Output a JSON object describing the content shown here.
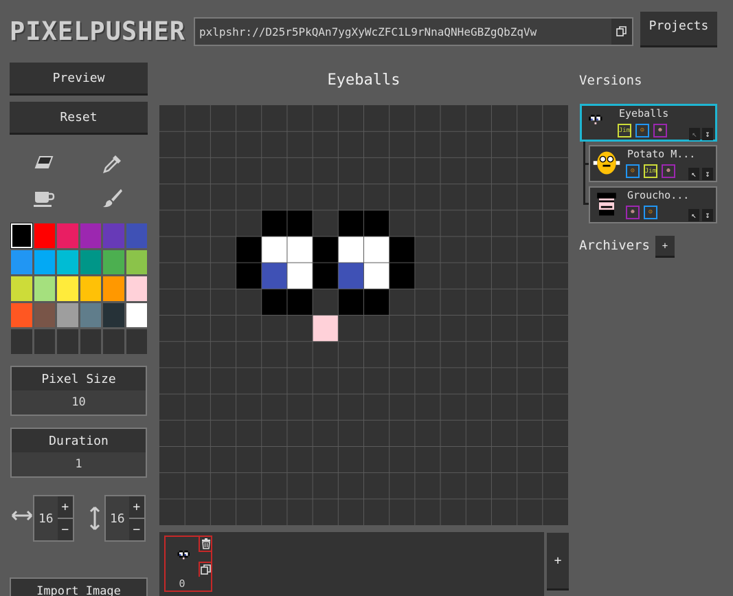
{
  "app": {
    "logo": "PIXELPUSHER",
    "url": "pxlpshr://D25r5PkQAn7ygXyWcZFC1L9rNnaQNHeGBZgQbZqVw",
    "projects_label": "Projects"
  },
  "left_panel": {
    "preview_label": "Preview",
    "reset_label": "Reset",
    "tools": [
      "eraser-icon",
      "eyedropper-icon",
      "fill-bucket-icon",
      "brush-icon"
    ],
    "palette": [
      "#000000",
      "#ff0000",
      "#e91e63",
      "#9c27b0",
      "#673ab7",
      "#3f51b5",
      "#2196f3",
      "#03a9f4",
      "#00bcd4",
      "#009688",
      "#4caf50",
      "#8bc34a",
      "#cddc39",
      "#a5e07e",
      "#ffeb3b",
      "#ffc107",
      "#ff9800",
      "#ffd1d9",
      "#ff5722",
      "#795548",
      "#9e9e9e",
      "#607d8b",
      "#263238",
      "#ffffff",
      "#333333",
      "#333333",
      "#333333",
      "#333333",
      "#333333",
      "#333333"
    ],
    "selected_swatch": 0,
    "pixel_size": {
      "label": "Pixel Size",
      "value": "10"
    },
    "duration": {
      "label": "Duration",
      "value": "1"
    },
    "width": {
      "value": "16",
      "plus": "+",
      "minus": "−"
    },
    "height": {
      "value": "16",
      "plus": "+",
      "minus": "−"
    },
    "import_label": "Import Image"
  },
  "canvas": {
    "title": "Eyeballs",
    "cols": 16,
    "rows": 16,
    "background": "#333333",
    "grid_color": "#5a5a5a",
    "pixels": [
      {
        "x": 4,
        "y": 4,
        "c": "#000000"
      },
      {
        "x": 5,
        "y": 4,
        "c": "#000000"
      },
      {
        "x": 7,
        "y": 4,
        "c": "#000000"
      },
      {
        "x": 8,
        "y": 4,
        "c": "#000000"
      },
      {
        "x": 3,
        "y": 5,
        "c": "#000000"
      },
      {
        "x": 4,
        "y": 5,
        "c": "#ffffff"
      },
      {
        "x": 5,
        "y": 5,
        "c": "#ffffff"
      },
      {
        "x": 6,
        "y": 5,
        "c": "#000000"
      },
      {
        "x": 7,
        "y": 5,
        "c": "#ffffff"
      },
      {
        "x": 8,
        "y": 5,
        "c": "#ffffff"
      },
      {
        "x": 9,
        "y": 5,
        "c": "#000000"
      },
      {
        "x": 3,
        "y": 6,
        "c": "#000000"
      },
      {
        "x": 4,
        "y": 6,
        "c": "#3f51b5"
      },
      {
        "x": 5,
        "y": 6,
        "c": "#ffffff"
      },
      {
        "x": 6,
        "y": 6,
        "c": "#000000"
      },
      {
        "x": 7,
        "y": 6,
        "c": "#3f51b5"
      },
      {
        "x": 8,
        "y": 6,
        "c": "#ffffff"
      },
      {
        "x": 9,
        "y": 6,
        "c": "#000000"
      },
      {
        "x": 4,
        "y": 7,
        "c": "#000000"
      },
      {
        "x": 5,
        "y": 7,
        "c": "#000000"
      },
      {
        "x": 7,
        "y": 7,
        "c": "#000000"
      },
      {
        "x": 8,
        "y": 7,
        "c": "#000000"
      },
      {
        "x": 6,
        "y": 8,
        "c": "#ffd1d9"
      }
    ]
  },
  "frames": {
    "items": [
      {
        "index": "0"
      }
    ],
    "add_label": "+"
  },
  "versions": {
    "title": "Versions",
    "items": [
      {
        "name": "Eyeballs",
        "active": true,
        "tags": [
          "tag-jim",
          "tag-person",
          "tag-face"
        ]
      },
      {
        "name": "Potato M...",
        "active": false,
        "tags": [
          "tag-person",
          "tag-jim",
          "tag-face"
        ]
      },
      {
        "name": "Groucho...",
        "active": false,
        "tags": [
          "tag-face",
          "tag-person"
        ]
      }
    ],
    "colors": {
      "active_border": "#1fb6d3",
      "tag_jim": "#cddc39",
      "tag_person": "#2196f3",
      "tag_face": "#9c27b0"
    }
  },
  "archivers": {
    "title": "Archivers",
    "add_label": "+"
  }
}
